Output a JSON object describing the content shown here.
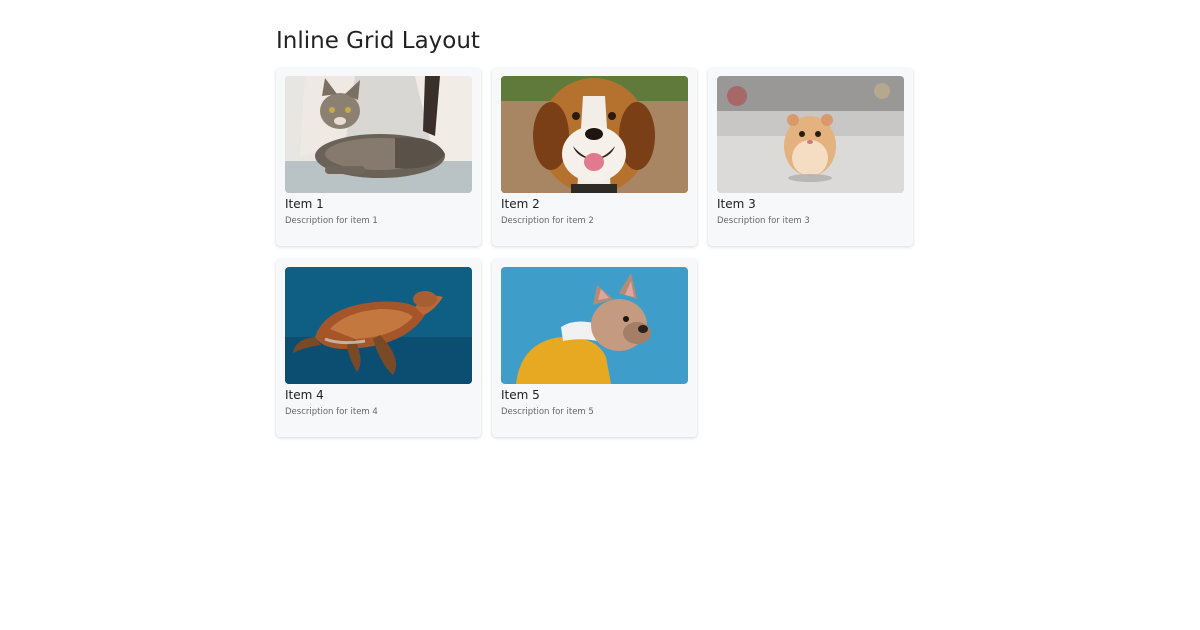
{
  "page": {
    "title": "Inline Grid Layout"
  },
  "items": [
    {
      "title": "Item 1",
      "description": "Description for item 1",
      "image": "tabby-cat-photo"
    },
    {
      "title": "Item 2",
      "description": "Description for item 2",
      "image": "beagle-dog-photo"
    },
    {
      "title": "Item 3",
      "description": "Description for item 3",
      "image": "hamster-photo"
    },
    {
      "title": "Item 4",
      "description": "Description for item 4",
      "image": "sea-turtle-photo"
    },
    {
      "title": "Item 5",
      "description": "Description for item 5",
      "image": "french-bulldog-photo"
    }
  ]
}
